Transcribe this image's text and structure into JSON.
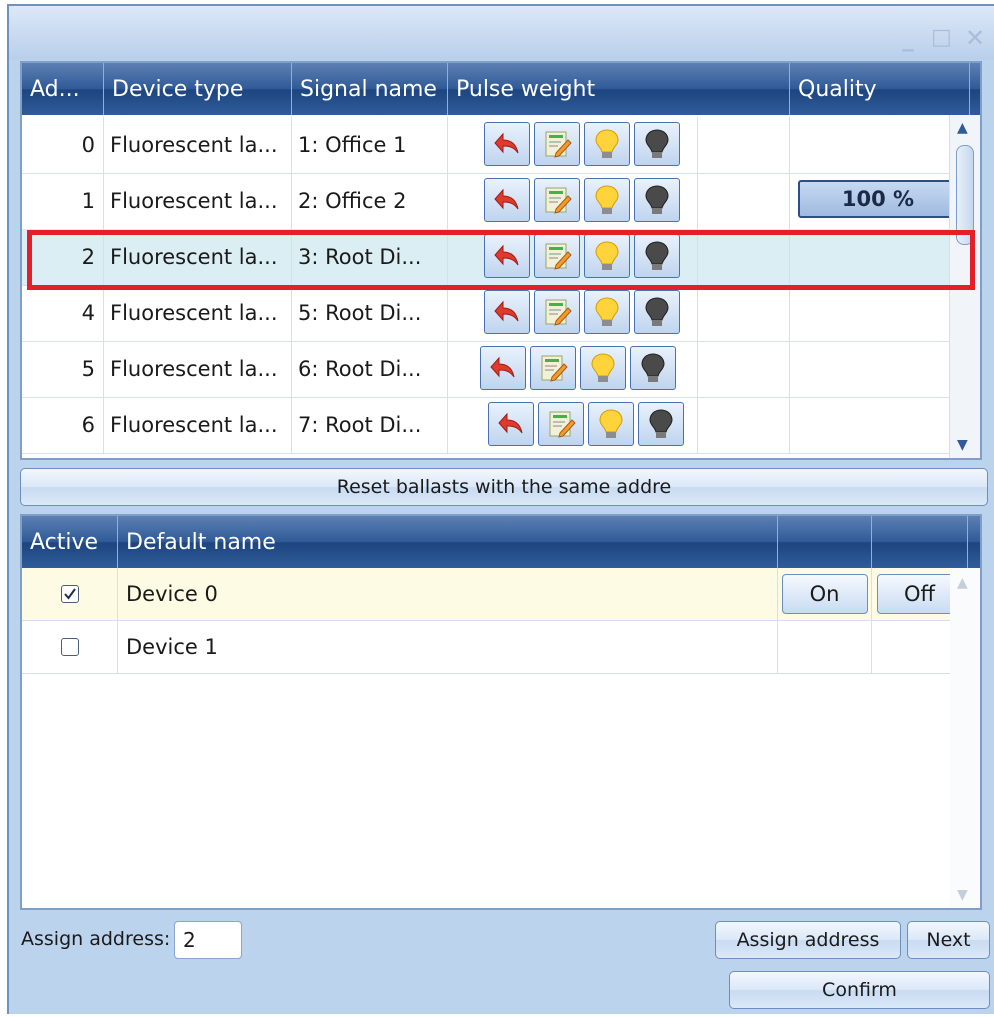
{
  "window": {
    "controls": {
      "minimize": "_",
      "maximize": "□",
      "close": "✕"
    }
  },
  "devices_grid": {
    "columns": [
      "Ad...",
      "Device type",
      "Signal name",
      "Pulse weight",
      "Quality"
    ],
    "rows": [
      {
        "address": "0",
        "device_type": "Fluorescent la...",
        "signal_name": "1: Office 1",
        "quality": ""
      },
      {
        "address": "1",
        "device_type": "Fluorescent la...",
        "signal_name": "2: Office 2",
        "quality": "100 %"
      },
      {
        "address": "2",
        "device_type": "Fluorescent la...",
        "signal_name": "3: Root Di...",
        "quality": ""
      },
      {
        "address": "4",
        "device_type": "Fluorescent la...",
        "signal_name": "5: Root Di...",
        "quality": ""
      },
      {
        "address": "5",
        "device_type": "Fluorescent la...",
        "signal_name": "6: Root Di...",
        "quality": ""
      },
      {
        "address": "6",
        "device_type": "Fluorescent la...",
        "signal_name": "7: Root Di...",
        "quality": ""
      }
    ],
    "quality_value_fraction": 1.0,
    "icons": [
      "undo-arrow-icon",
      "edit-note-icon",
      "bulb-on-icon",
      "bulb-off-icon"
    ]
  },
  "reset_button_label": "Reset ballasts with the same addre",
  "default_grid": {
    "columns": [
      "Active",
      "Default name",
      "",
      ""
    ],
    "rows": [
      {
        "active": true,
        "name": "Device 0",
        "on_label": "On",
        "off_label": "Off"
      },
      {
        "active": false,
        "name": "Device 1"
      }
    ]
  },
  "footer": {
    "assign_label": "Assign address:",
    "assign_value": "2",
    "assign_button": "Assign address",
    "next_button": "Next",
    "confirm_button": "Confirm"
  },
  "colors": {
    "header": "#2f5a97",
    "selection_highlight": "#e3202a",
    "selected_row": "#dbeef3"
  }
}
